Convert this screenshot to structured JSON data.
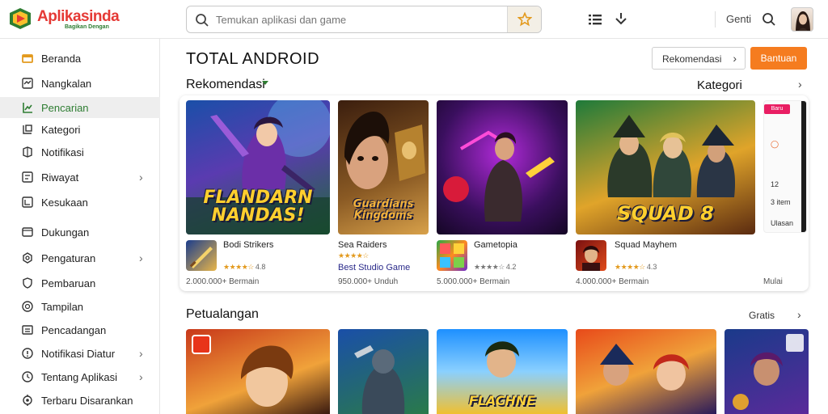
{
  "header": {
    "logo_text": "Aplikasinda",
    "logo_sub": "Bagikan Dengan",
    "search_placeholder": "Temukan aplikasi dan game",
    "text_link": "Genti"
  },
  "sidebar": {
    "items": [
      {
        "label": "Beranda",
        "icon": "home-icon"
      },
      {
        "label": "Nangkalan",
        "icon": "download-icon"
      },
      {
        "label": "Pencarian",
        "icon": "chart-icon",
        "active": true
      },
      {
        "label": "Kategori",
        "icon": "grid-icon"
      },
      {
        "label": "Notifikasi",
        "icon": "bell-icon"
      },
      {
        "label": "Riwayat",
        "icon": "history-icon",
        "chevron": true
      },
      {
        "label": "Kesukaan",
        "icon": "tag-icon"
      },
      {
        "label": "Dukungan",
        "icon": "folder-icon"
      },
      {
        "label": "Pengaturan",
        "icon": "gear-icon",
        "chevron": true
      },
      {
        "label": "Pembaruan",
        "icon": "shield-icon"
      },
      {
        "label": "Tampilan",
        "icon": "circle-icon"
      },
      {
        "label": "Pencadangan",
        "icon": "archive-icon"
      },
      {
        "label": "Notifikasi Diatur",
        "icon": "info-icon",
        "chevron": true
      },
      {
        "label": "Tentang Aplikasi",
        "icon": "clock-icon",
        "chevron": true
      },
      {
        "label": "Terbaru Disarankan",
        "icon": "settings-icon"
      }
    ]
  },
  "main": {
    "title": "TOTAL ANDROID",
    "sort_label": "Rekomendasi",
    "primary_label": "Bantuan"
  },
  "section1": {
    "title": "Rekomendasi",
    "right_label": "Kategori",
    "cards": [
      {
        "art_title": "FLANDARN NANDAS!",
        "name": "Bodi Strikers",
        "stars": "★★★★☆",
        "rating": "4.8",
        "developer": "",
        "meta": "2.000.000+ Bermain"
      },
      {
        "art_title": "Guardians Kingdoms",
        "name": "Sea Raiders",
        "stars": "★★★★☆",
        "rating": "",
        "developer": "Best Studio Game",
        "meta": "950.000+ Unduh"
      },
      {
        "art_title": "",
        "name": "Gametopia",
        "stars": "★★★★☆",
        "rating": "4.2",
        "developer": "",
        "meta": "5.000.000+ Bermain"
      },
      {
        "art_title": "SQUAD 8",
        "name": "Squad Mayhem",
        "stars": "★★★★☆",
        "rating": "4.3",
        "developer": "",
        "meta": "4.000.000+ Bermain"
      }
    ],
    "cut": {
      "badge": "Baru",
      "rows": [
        "12",
        "3 item",
        "Ulasan"
      ],
      "footer": "Mulai"
    }
  },
  "section2": {
    "title": "Petualangan",
    "right_label": "Gratis"
  },
  "colors": {
    "accent_orange": "#f57c1f",
    "brand_red": "#e53935",
    "brand_green": "#2e7d32"
  }
}
